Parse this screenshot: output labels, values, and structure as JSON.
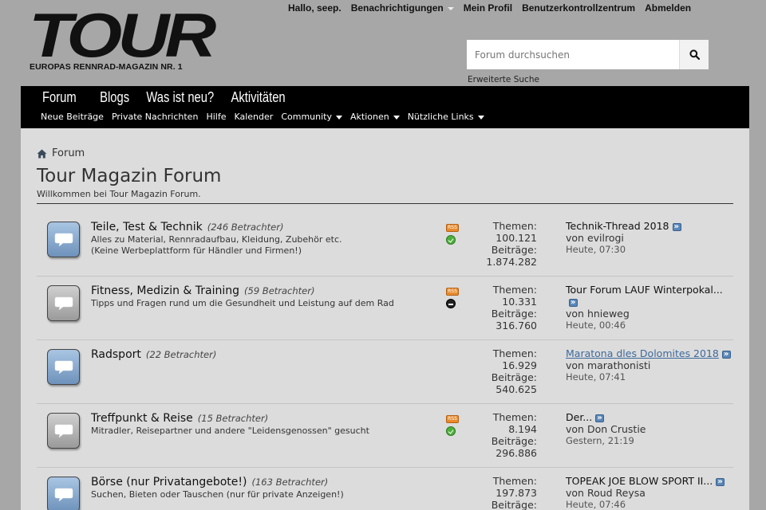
{
  "logo": {
    "text": "TOUR",
    "tagline": "EUROPAS RENNRAD-MAGAZIN NR. 1"
  },
  "toplinks": {
    "greeting": "Hallo, seep.",
    "notifications": "Benachrichtigungen",
    "profile": "Mein Profil",
    "usercp": "Benutzerkontrollzentrum",
    "logout": "Abmelden"
  },
  "search": {
    "placeholder": "Forum durchsuchen",
    "advanced": "Erweiterte Suche",
    "icon": "search-icon"
  },
  "nav": {
    "main": [
      "Forum",
      "Blogs",
      "Was ist neu?",
      "Aktivitäten"
    ],
    "sub": [
      {
        "label": "Neue Beiträge",
        "dropdown": false
      },
      {
        "label": "Private Nachrichten",
        "dropdown": false
      },
      {
        "label": "Hilfe",
        "dropdown": false
      },
      {
        "label": "Kalender",
        "dropdown": false
      },
      {
        "label": "Community",
        "dropdown": true
      },
      {
        "label": "Aktionen",
        "dropdown": true
      },
      {
        "label": "Nützliche Links",
        "dropdown": true
      }
    ]
  },
  "breadcrumb": {
    "home_icon": "home-icon",
    "label": "Forum"
  },
  "page": {
    "title": "Tour Magazin Forum",
    "welcome": "Willkommen bei Tour Magazin Forum."
  },
  "forums": [
    {
      "name": "Teile, Test & Technik",
      "viewers": "(246 Betrachter)",
      "desc_lines": [
        "Alles zu Material, Rennradaufbau, Kleidung, Zubehör etc.",
        "(Keine Werbeplattform für Händler und Firmen!)"
      ],
      "icon_color": "blue",
      "rss": true,
      "status": "new",
      "themen_label": "Themen:",
      "themen": "100.121",
      "beitraege_label": "Beiträge:",
      "beitraege": "1.874.282",
      "last_title": "Technik-Thread 2018",
      "last_title_link": false,
      "last_by": "von evilrogi",
      "last_time": "Heute, 07:30"
    },
    {
      "name": "Fitness, Medizin & Training",
      "viewers": "(59 Betrachter)",
      "desc_lines": [
        "Tipps und Fragen rund um die Gesundheit und Leistung auf dem Rad"
      ],
      "icon_color": "grey",
      "rss": true,
      "status": "old",
      "themen_label": "Themen:",
      "themen": "10.331",
      "beitraege_label": "Beiträge:",
      "beitraege": "316.760",
      "last_title": "Tour Forum LAUF Winterpokal...",
      "last_title_link": false,
      "last_by": "von hnieweg",
      "last_time": "Heute, 00:46"
    },
    {
      "name": "Radsport",
      "viewers": "(22 Betrachter)",
      "desc_lines": [],
      "icon_color": "blue",
      "rss": false,
      "status": "none",
      "themen_label": "Themen:",
      "themen": "16.929",
      "beitraege_label": "Beiträge:",
      "beitraege": "540.625",
      "last_title": "Maratona dles Dolomites 2018",
      "last_title_link": true,
      "last_by": "von marathonisti",
      "last_time": "Heute, 07:41"
    },
    {
      "name": "Treffpunkt & Reise",
      "viewers": "(15 Betrachter)",
      "desc_lines": [
        "Mitradler, Reisepartner und andere \"Leidensgenossen\" gesucht"
      ],
      "icon_color": "grey",
      "rss": true,
      "status": "new",
      "themen_label": "Themen:",
      "themen": "8.194",
      "beitraege_label": "Beiträge:",
      "beitraege": "296.886",
      "last_title": "Der...",
      "last_title_link": false,
      "last_by": "von Don Crustie",
      "last_time": "Gestern, 21:19"
    },
    {
      "name": "Börse (nur Privatangebote!)",
      "viewers": "(163 Betrachter)",
      "desc_lines": [
        "Suchen, Bieten oder Tauschen (nur für private Anzeigen!)"
      ],
      "icon_color": "blue",
      "rss": false,
      "status": "none",
      "themen_label": "Themen:",
      "themen": "197.873",
      "beitraege_label": "Beiträge:",
      "beitraege": "",
      "last_title": "TOPEAK JOE BLOW SPORT II...",
      "last_title_link": false,
      "last_by": "von Roud Reysa",
      "last_time": "Heute, 07:46"
    }
  ],
  "colors": {
    "page_bg": "#a7a7a7",
    "content_bg": "#dcdcdc",
    "navbar_bg": "#000000",
    "link": "#3d6a9c",
    "rss": "#e98b2c",
    "status_new": "#4caf3a"
  }
}
